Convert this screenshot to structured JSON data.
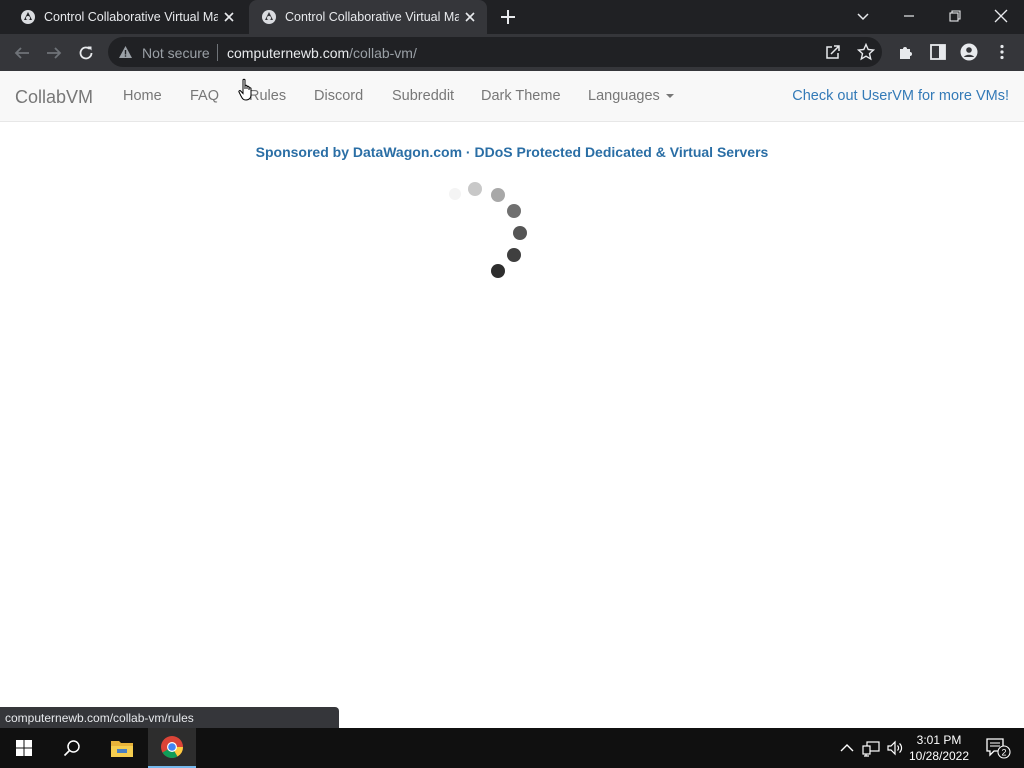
{
  "browser": {
    "tabs": [
      {
        "title": "Control Collaborative Virtual Machines!",
        "active": false
      },
      {
        "title": "Control Collaborative Virtual Machines!",
        "active": true
      }
    ],
    "security_label": "Not secure",
    "url_host": "computernewb.com",
    "url_path": "/collab-vm/",
    "status_url": "computernewb.com/collab-vm/rules"
  },
  "navbar": {
    "brand": "CollabVM",
    "links": [
      "Home",
      "FAQ",
      "Rules",
      "Discord",
      "Subreddit",
      "Dark Theme",
      "Languages"
    ],
    "uservm_link": "Check out UserVM for more VMs!"
  },
  "content": {
    "sponsor_text": "Sponsored by DataWagon.com · DDoS Protected Dedicated & Virtual Servers"
  },
  "taskbar": {
    "time": "3:01 PM",
    "date": "10/28/2022",
    "notification_count": "2"
  },
  "colors": {
    "link": "#337ab7",
    "sponsor": "#2a6ea5",
    "chrome_dark": "#202124",
    "chrome_toolbar": "#35363a",
    "taskbar": "#101010"
  }
}
